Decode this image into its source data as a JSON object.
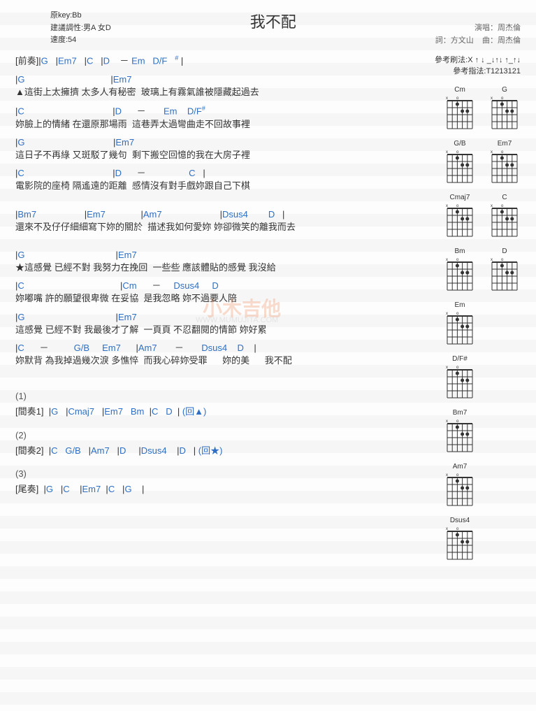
{
  "meta": {
    "key_line": "原key:Bb",
    "suggest_line": "建議調性:男A 女D",
    "tempo_line": "速度:54"
  },
  "title": "我不配",
  "credits": {
    "singer_label": "演唱：",
    "singer": "周杰倫",
    "lyrics_label": "詞：",
    "lyricist": "方文山",
    "composer_label": "曲：",
    "composer": "周杰倫"
  },
  "pattern": {
    "strum_label": "參考刷法:",
    "strum": "X ↑ ↓ _↓↑↓ ↑_↑↓",
    "pick_label": "參考指法:",
    "pick": "T1213121"
  },
  "intro": {
    "label": "[前奏]",
    "chords": [
      "|G",
      "|Em7",
      "|C",
      "|D",
      "－",
      "Em",
      "D/F",
      "#",
      "|"
    ]
  },
  "verse1": [
    {
      "chords": "|G                                  |Em7",
      "lyrics": "▲這街上太擁擠 太多人有秘密  玻璃上有霧氣誰被隱藏起過去"
    },
    {
      "chords": "|C                                   |D      －       Em    D/F#",
      "lyrics": "妳臉上的情緒 在還原那場雨  這巷弄太過彎曲走不回故事裡"
    },
    {
      "chords": "|G                                   |Em7",
      "lyrics": "這日子不再綠 又斑駁了幾句  剩下搬空回憶的我在大房子裡"
    },
    {
      "chords": "|C                                   |D      －                 C   |",
      "lyrics": "電影院的座椅 隔遙遠的距離  感情沒有對手戲妳跟自己下棋"
    }
  ],
  "pre": [
    {
      "chords": "|Bm7                   |Em7              |Am7                       |Dsus4        D   |",
      "lyrics": "還來不及仔仔細細寫下妳的關於  描述我如何愛妳 妳卻微笑的離我而去"
    }
  ],
  "chorus": [
    {
      "chords": "|G                                    |Em7",
      "lyrics": "★這感覺 已經不對 我努力在挽回  一些些 應該體貼的感覺 我沒給"
    },
    {
      "chords": "|C                                      |Cm      －     Dsus4     D",
      "lyrics": "妳嘟嘴 許的願望很卑微 在妥協  是我忽略 妳不過要人陪"
    },
    {
      "chords": "|G                                    |Em7",
      "lyrics": "這感覺 已經不對 我最後才了解  一頁頁 不忍翻閱的情節 妳好累"
    },
    {
      "chords": "|C      －          G/B     Em7      |Am7       －       Dsus4    D    |",
      "lyrics": "妳默背 為我掉過幾次淚 多憔悴  而我心碎妳受罪      妳的美      我不配"
    }
  ],
  "outros": [
    {
      "num": "(1)",
      "label": "[間奏1]",
      "chords": "|G   |Cmaj7   |Em7   Bm  |C   D  | (回▲)"
    },
    {
      "num": "(2)",
      "label": "[間奏2]",
      "chords": "|C   G/B   |Am7   |D     |Dsus4    |D   | (回★)"
    },
    {
      "num": "(3)",
      "label": "[尾奏]",
      "chords": "|G   |C    |Em7  |C   |G    |"
    }
  ],
  "chord_diagrams": [
    [
      "Cm",
      "G"
    ],
    [
      "G/B",
      "Em7"
    ],
    [
      "Cmaj7",
      "C"
    ],
    [
      "Bm",
      "D"
    ],
    [
      "Em"
    ],
    [
      "D/F#"
    ],
    [
      "Bm7"
    ],
    [
      "Am7"
    ],
    [
      "Dsus4"
    ]
  ],
  "watermark": {
    "text": "小木吉他",
    "url": "WWW.MUMUJITA.COM"
  }
}
